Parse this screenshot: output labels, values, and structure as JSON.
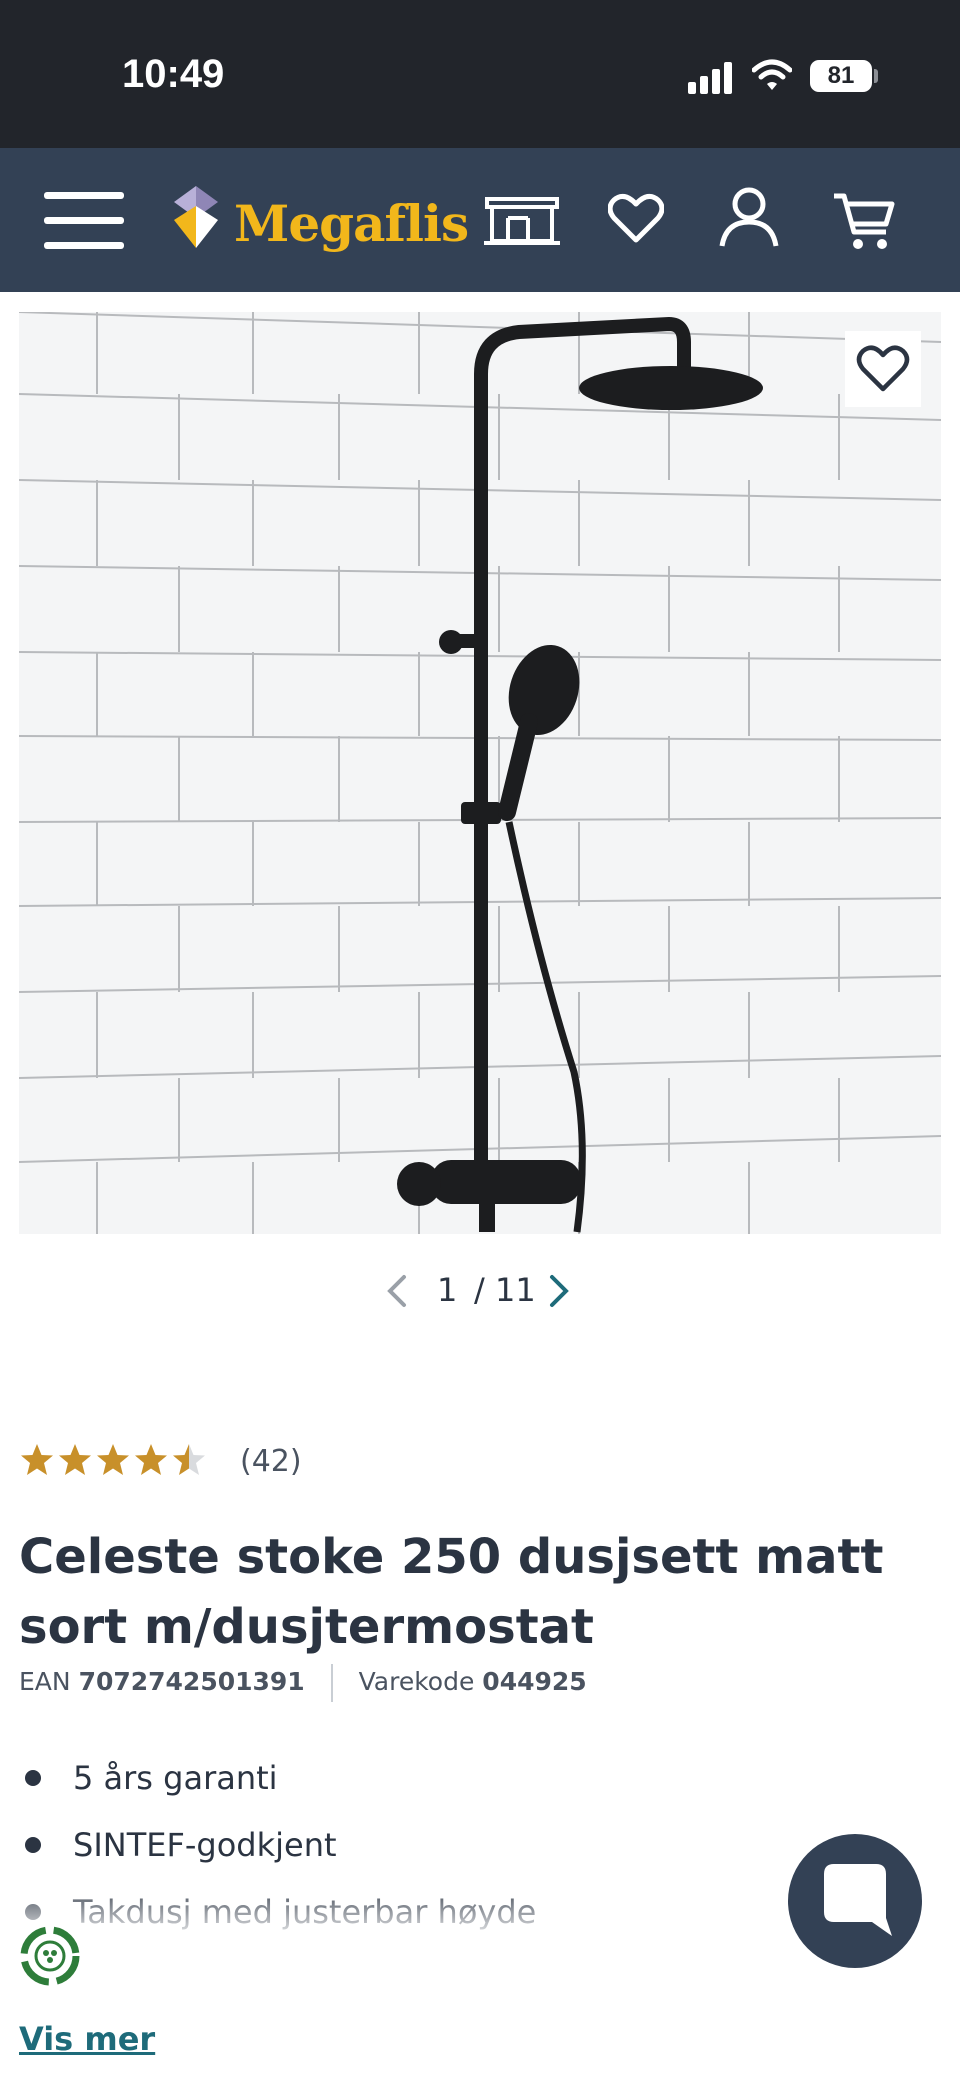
{
  "status_bar": {
    "time": "10:49",
    "battery": "81"
  },
  "nav": {
    "brand": "Megaflis",
    "icons": [
      "menu-icon",
      "store-icon",
      "heart-icon",
      "user-icon",
      "cart-icon"
    ]
  },
  "gallery": {
    "current": "1",
    "total": "/ 11"
  },
  "product": {
    "rating_value": 4.5,
    "rating_max": 5,
    "review_count": "(42)",
    "title": "Celeste stoke 250 dusjsett matt sort m/dusjtermostat",
    "ean_label": "EAN",
    "ean": "7072742501391",
    "code_label": "Varekode",
    "code": "044925",
    "features": [
      "5 års garanti",
      "SINTEF-godkjent",
      "Takdusj med justerbar høyde"
    ],
    "show_more": "Vis mer"
  },
  "colors": {
    "nav_bg": "#334155",
    "brand": "#f2b71b",
    "star": "#c8902a",
    "link": "#1e6b7a"
  }
}
